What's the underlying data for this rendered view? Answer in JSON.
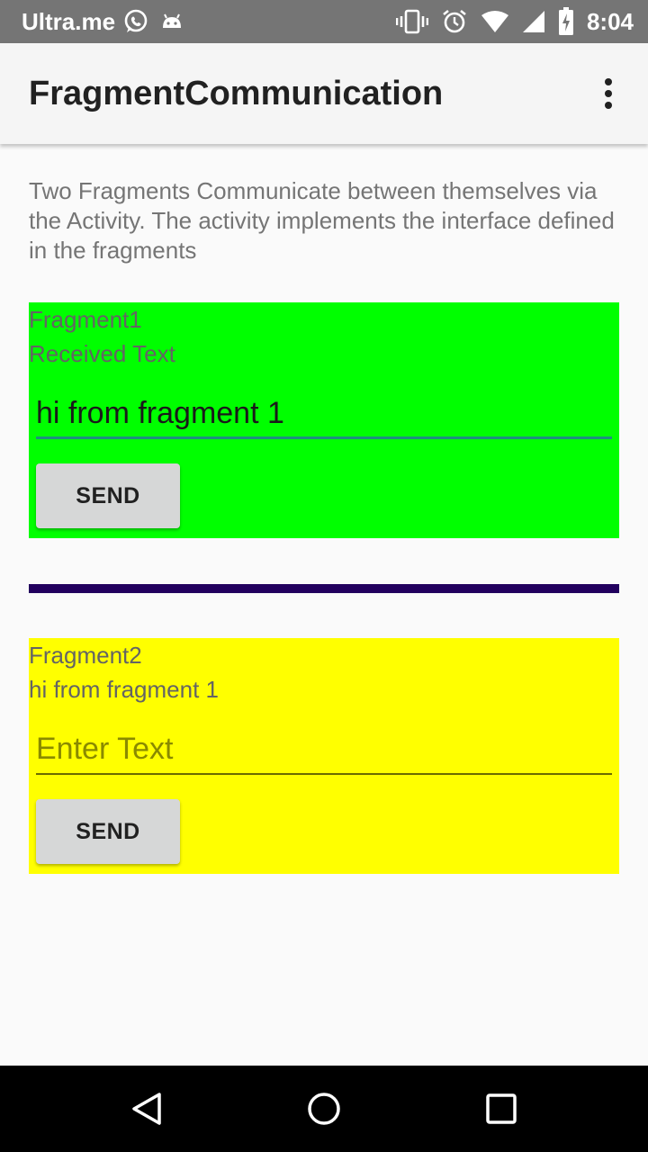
{
  "status_bar": {
    "carrier": "Ultra.me",
    "time": "8:04",
    "icons": [
      "whatsapp-icon",
      "android-icon",
      "vibrate-icon",
      "alarm-icon",
      "wifi-icon",
      "signal-icon",
      "battery-icon"
    ]
  },
  "app_bar": {
    "title": "FragmentCommunication",
    "overflow_icon": "more-vert-icon"
  },
  "description": "Two Fragments Communicate between themselves via the Activity. The activity implements the interface defined in the fragments",
  "fragment1": {
    "title": "Fragment1",
    "received_text": "Received Text",
    "input_value": "hi from fragment 1",
    "input_placeholder": "",
    "send_label": "SEND",
    "background": "#00ff00"
  },
  "divider_color": "#22005e",
  "fragment2": {
    "title": "Fragment2",
    "received_text": "hi from fragment 1",
    "input_value": "",
    "input_placeholder": "Enter Text",
    "send_label": "SEND",
    "background": "#ffff00"
  },
  "nav_bar": {
    "icons": [
      "back-icon",
      "home-icon",
      "recents-icon"
    ]
  }
}
